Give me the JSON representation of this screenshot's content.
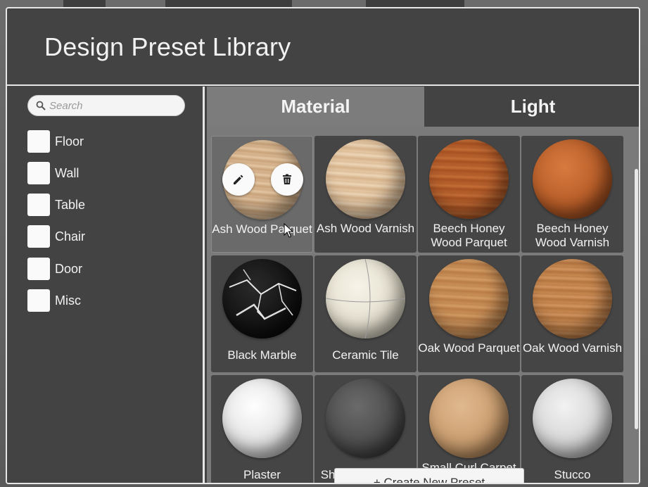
{
  "window": {
    "title": "Design Preset Library"
  },
  "search": {
    "placeholder": "Search",
    "value": ""
  },
  "categories": [
    {
      "label": "Floor",
      "checked": false
    },
    {
      "label": "Wall",
      "checked": false
    },
    {
      "label": "Table",
      "checked": false
    },
    {
      "label": "Chair",
      "checked": false
    },
    {
      "label": "Door",
      "checked": false
    },
    {
      "label": "Misc",
      "checked": false
    }
  ],
  "tabs": [
    {
      "label": "Material",
      "active": true
    },
    {
      "label": "Light",
      "active": false
    }
  ],
  "presets": [
    {
      "name": "Ash Wood Parquet",
      "selected": true
    },
    {
      "name": "Ash Wood Varnish"
    },
    {
      "name": "Beech Honey Wood Parquet"
    },
    {
      "name": "Beech Honey Wood Varnish"
    },
    {
      "name": "Black Marble"
    },
    {
      "name": "Ceramic Tile"
    },
    {
      "name": "Oak Wood Parquet"
    },
    {
      "name": "Oak Wood Varnish"
    },
    {
      "name": "Plaster"
    },
    {
      "name": "Short Cut Carpet"
    },
    {
      "name": "Small Curl Carpet"
    },
    {
      "name": "Stucco"
    }
  ],
  "card_actions": {
    "edit_icon": "pencil-icon",
    "delete_icon": "trash-icon"
  },
  "create_button": {
    "label": "+ Create New Preset"
  }
}
